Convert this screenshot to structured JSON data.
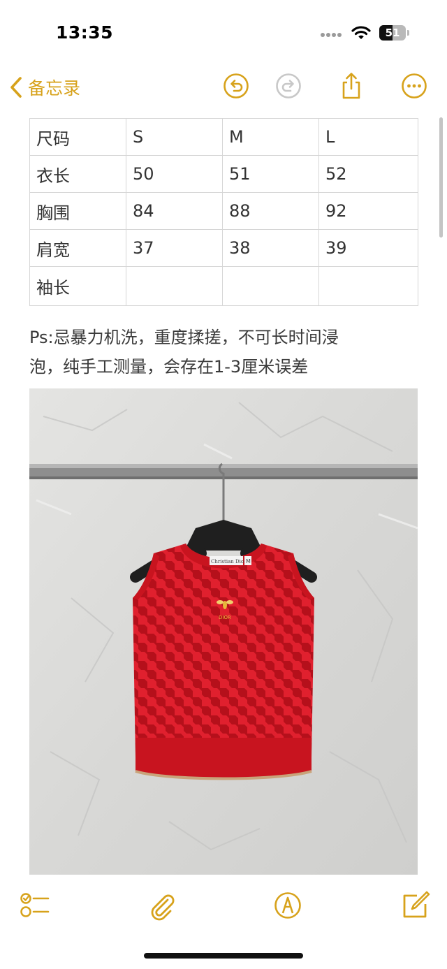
{
  "status_bar": {
    "time": "13:35",
    "battery_level": "51"
  },
  "nav": {
    "back_label": "备忘录",
    "icons": [
      "chevron-left-icon",
      "undo-icon",
      "redo-icon",
      "share-icon",
      "more-icon"
    ]
  },
  "table": {
    "rows": [
      [
        "尺码",
        "S",
        "M",
        "L"
      ],
      [
        "衣长",
        "50",
        "51",
        "52"
      ],
      [
        "胸围",
        "84",
        "88",
        "92"
      ],
      [
        "肩宽",
        "37",
        "38",
        "39"
      ],
      [
        "袖长",
        "",
        "",
        ""
      ]
    ]
  },
  "note": {
    "line1": "Ps:忌暴力机洗，重度揉搓，不可长时间浸",
    "line2": "泡，纯手工测量，会存在1-3厘米误差"
  },
  "photo": {
    "label_text": "Christian Dior",
    "logo_text": "DIOR",
    "size_tag": "M"
  },
  "toolbar": {
    "icons": [
      "checklist-icon",
      "paperclip-icon",
      "markup-icon",
      "compose-icon"
    ]
  },
  "colors": {
    "accent": "#d7a21b",
    "garment_red": "#e0202e",
    "houndstooth_dark": "#b5101b"
  }
}
